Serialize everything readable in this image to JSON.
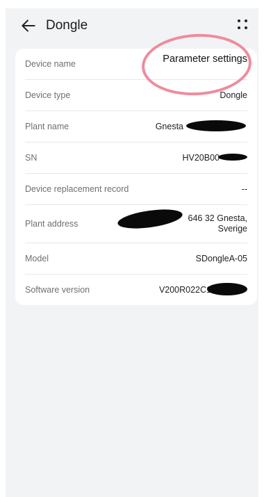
{
  "header": {
    "title": "Dongle"
  },
  "details": [
    {
      "label": "Device name",
      "value": "Parameter settings"
    },
    {
      "label": "Device type",
      "value": "Dongle"
    },
    {
      "label": "Plant name",
      "value": "Gnesta"
    },
    {
      "label": "SN",
      "value": "HV20B00"
    },
    {
      "label": "Device replacement record",
      "value": "--"
    },
    {
      "label": "Plant address",
      "value": "646 32 Gnesta, Sverige"
    },
    {
      "label": "Model",
      "value": "SDongleA-05"
    },
    {
      "label": "Software version",
      "value": "V200R022C1"
    }
  ],
  "annotation_color": "#ef8b9d"
}
